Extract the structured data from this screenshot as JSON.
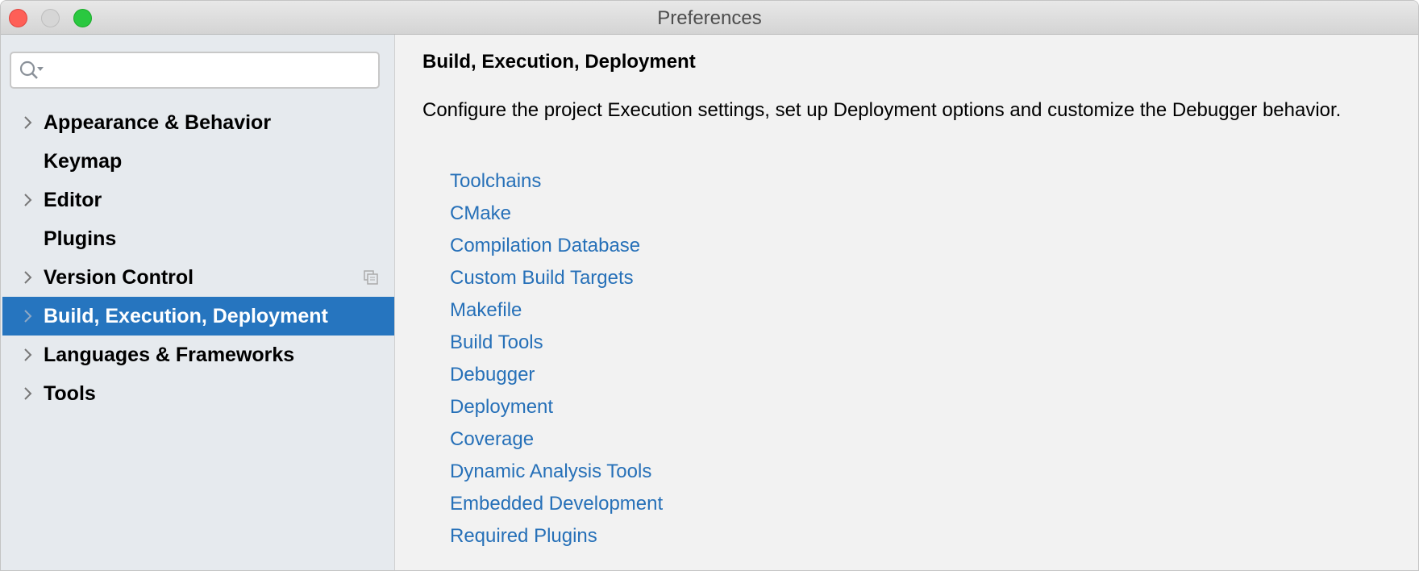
{
  "window": {
    "title": "Preferences"
  },
  "search": {
    "value": "",
    "placeholder": ""
  },
  "sidebar": {
    "items": [
      {
        "label": "Appearance & Behavior",
        "expandable": true
      },
      {
        "label": "Keymap",
        "expandable": false
      },
      {
        "label": "Editor",
        "expandable": true
      },
      {
        "label": "Plugins",
        "expandable": false
      },
      {
        "label": "Version Control",
        "expandable": true
      },
      {
        "label": "Build, Execution, Deployment",
        "expandable": true,
        "selected": true
      },
      {
        "label": "Languages & Frameworks",
        "expandable": true
      },
      {
        "label": "Tools",
        "expandable": true
      }
    ]
  },
  "content": {
    "heading": "Build, Execution, Deployment",
    "description": "Configure the project Execution settings, set up Deployment options and customize the Debugger behavior.",
    "links": [
      "Toolchains",
      "CMake",
      "Compilation Database",
      "Custom Build Targets",
      "Makefile",
      "Build Tools",
      "Debugger",
      "Deployment",
      "Coverage",
      "Dynamic Analysis Tools",
      "Embedded Development",
      "Required Plugins"
    ]
  },
  "colors": {
    "accent": "#2675bf",
    "link": "#2670b8"
  }
}
